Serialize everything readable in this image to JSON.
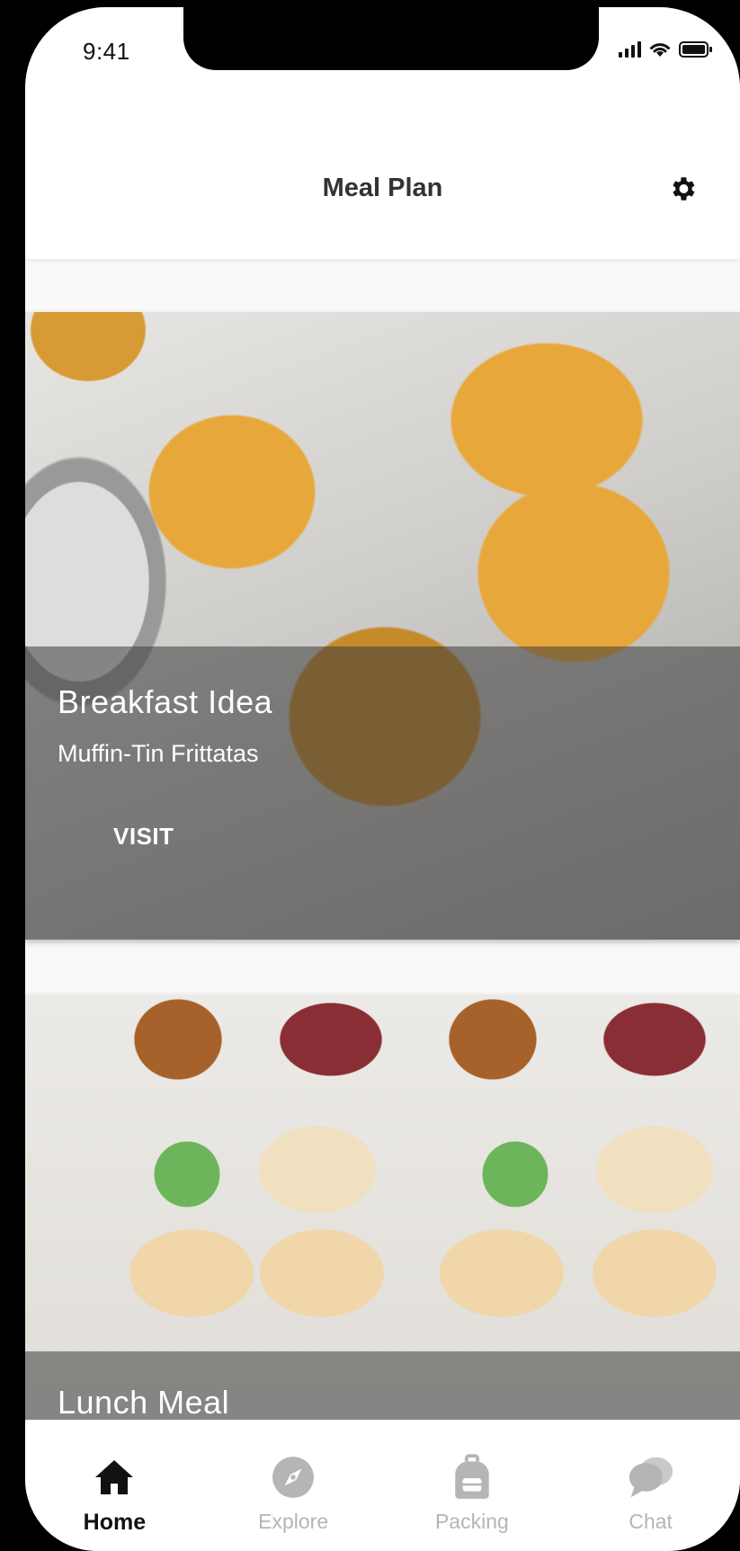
{
  "status_bar": {
    "time": "9:41"
  },
  "header": {
    "title": "Meal Plan",
    "settings_icon": "gear-icon"
  },
  "cards": [
    {
      "title": "Breakfast Idea",
      "subtitle": "Muffin-Tin Frittatas",
      "action_label": "VISIT"
    },
    {
      "title": "Lunch Meal"
    }
  ],
  "tabs": [
    {
      "label": "Home",
      "icon": "home-icon",
      "active": true
    },
    {
      "label": "Explore",
      "icon": "compass-icon",
      "active": false
    },
    {
      "label": "Packing",
      "icon": "backpack-icon",
      "active": false
    },
    {
      "label": "Chat",
      "icon": "chat-icon",
      "active": false
    }
  ],
  "colors": {
    "active_tab": "#111111",
    "inactive_tab": "#b5b5b5",
    "overlay": "rgba(60,60,60,0.55)"
  }
}
